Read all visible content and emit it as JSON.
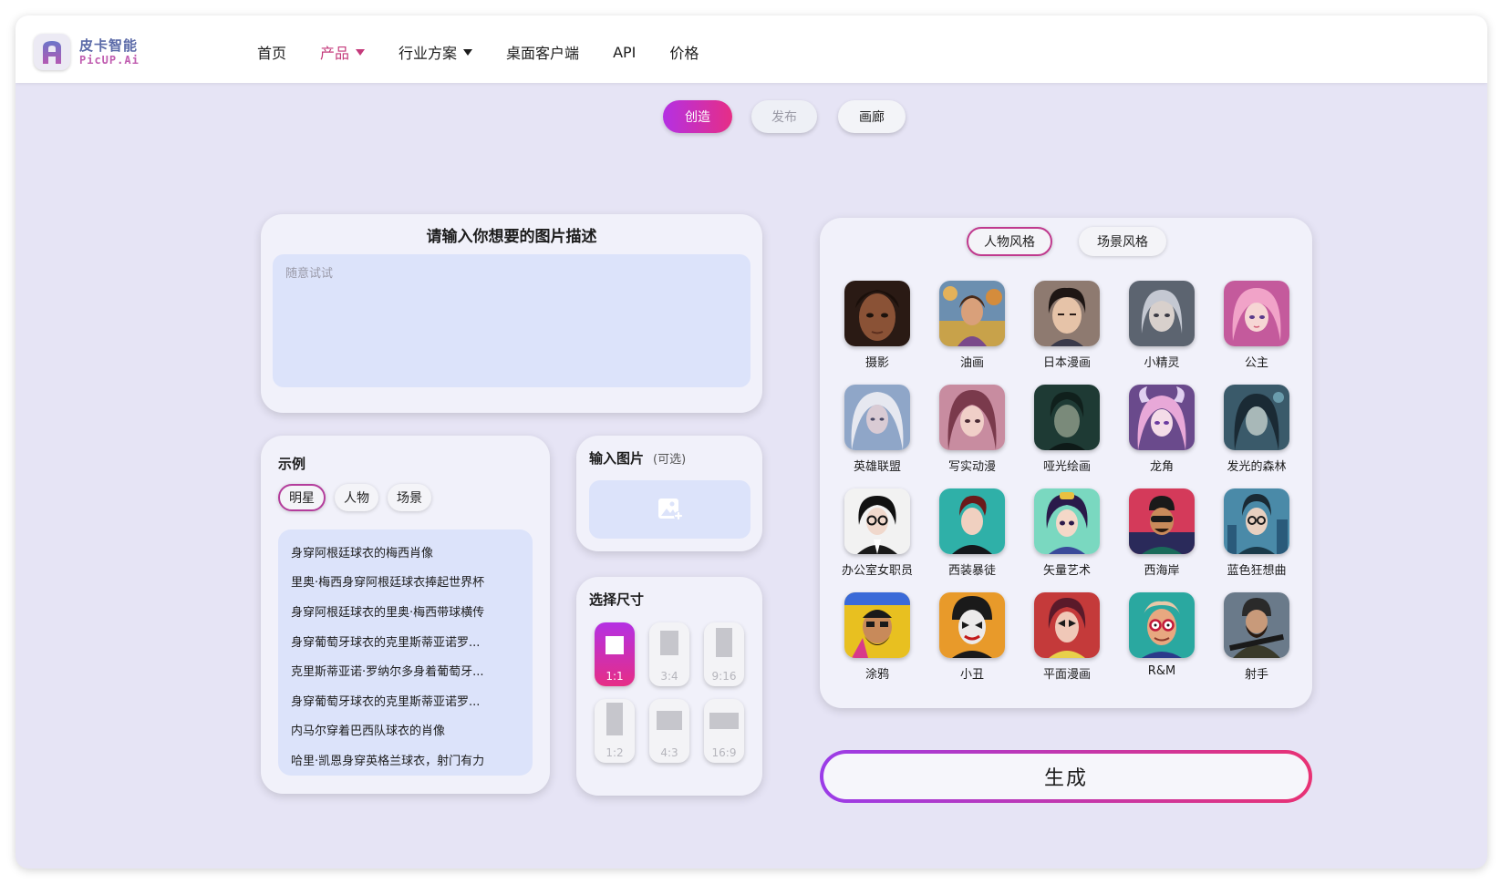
{
  "brand": {
    "name_cn": "皮卡智能",
    "name_en": "PicUP.Ai",
    "logo_letter": "A"
  },
  "nav": {
    "items": [
      "首页",
      "产品",
      "行业方案",
      "桌面客户端",
      "API",
      "价格"
    ],
    "active": "产品"
  },
  "mode_tabs": {
    "create": "创造",
    "publish": "发布",
    "gallery": "画廊",
    "active": "创造"
  },
  "prompt": {
    "title": "请输入你想要的图片描述",
    "placeholder": "随意试试",
    "value": ""
  },
  "examples": {
    "title": "示例",
    "tabs": [
      "明星",
      "人物",
      "场景"
    ],
    "active_tab": "明星",
    "items": [
      "身穿阿根廷球衣的梅西肖像",
      "里奥·梅西身穿阿根廷球衣捧起世界杯",
      "身穿阿根廷球衣的里奥·梅西带球横传",
      "身穿葡萄牙球衣的克里斯蒂亚诺罗...",
      "克里斯蒂亚诺·罗纳尔多身着葡萄牙...",
      "身穿葡萄牙球衣的克里斯蒂亚诺罗...",
      "内马尔穿着巴西队球衣的肖像",
      "哈里·凯恩身穿英格兰球衣，射门有力"
    ]
  },
  "upload": {
    "title": "输入图片",
    "optional": "(可选)",
    "icon": "image-add-icon"
  },
  "size": {
    "title": "选择尺寸",
    "options": [
      "1:1",
      "3:4",
      "9:16",
      "1:2",
      "4:3",
      "16:9"
    ],
    "selected": "1:1"
  },
  "styles": {
    "tabs": [
      "人物风格",
      "场景风格"
    ],
    "active_tab": "人物风格",
    "items": [
      "摄影",
      "油画",
      "日本漫画",
      "小精灵",
      "公主",
      "英雄联盟",
      "写实动漫",
      "哑光绘画",
      "龙角",
      "发光的森林",
      "办公室女职员",
      "西装暴徒",
      "矢量艺术",
      "西海岸",
      "蓝色狂想曲",
      "涂鸦",
      "小丑",
      "平面漫画",
      "R&M",
      "射手"
    ]
  },
  "generate_label": "生成",
  "colors": {
    "accent_start": "#b430e3",
    "accent_end": "#e62e86",
    "nav_active": "#c43a7b",
    "background": "#e6e4f5"
  }
}
